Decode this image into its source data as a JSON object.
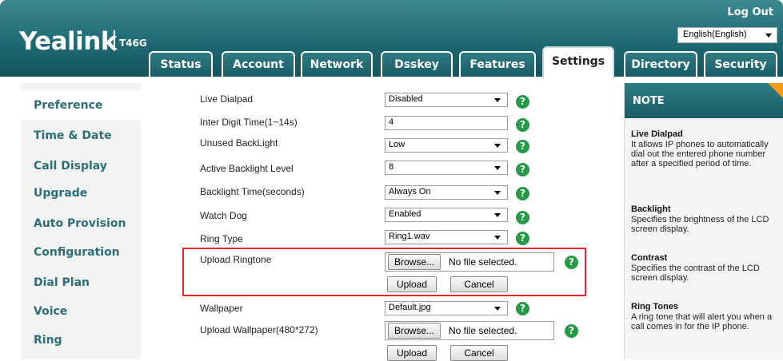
{
  "header": {
    "brand": "Yealink",
    "model": "T46G",
    "logout": "Log Out",
    "language": "English(English)",
    "tabs": [
      "Status",
      "Account",
      "Network",
      "Dsskey",
      "Features",
      "Settings",
      "Directory",
      "Security"
    ],
    "active_tab": "Settings"
  },
  "sidebar": {
    "items": [
      "Preference",
      "Time & Date",
      "Call Display",
      "Upgrade",
      "Auto Provision",
      "Configuration",
      "Dial Plan",
      "Voice",
      "Ring"
    ],
    "active": "Preference"
  },
  "form": {
    "live_dialpad": {
      "label": "Live Dialpad",
      "value": "Disabled"
    },
    "inter_digit": {
      "label": "Inter Digit Time(1~14s)",
      "value": "4"
    },
    "unused_backlight": {
      "label": "Unused BackLight",
      "value": "Low"
    },
    "active_backlight": {
      "label": "Active Backlight Level",
      "value": "8"
    },
    "backlight_time": {
      "label": "Backlight Time(seconds)",
      "value": "Always On"
    },
    "watch_dog": {
      "label": "Watch Dog",
      "value": "Enabled"
    },
    "ring_type": {
      "label": "Ring Type",
      "value": "Ring1.wav"
    },
    "upload_ringtone": {
      "label": "Upload Ringtone",
      "browse": "Browse...",
      "no_file": "No file selected.",
      "upload": "Upload",
      "cancel": "Cancel"
    },
    "wallpaper": {
      "label": "Wallpaper",
      "value": "Default.jpg"
    },
    "upload_wallpaper": {
      "label": "Upload Wallpaper(480*272)",
      "browse": "Browse...",
      "no_file": "No file selected.",
      "upload": "Upload",
      "cancel": "Cancel"
    },
    "help_glyph": "?"
  },
  "note": {
    "title": "NOTE",
    "sections": [
      {
        "heading": "Live Dialpad",
        "text": "It allows IP phones to automatically dial out the entered phone number after a specified period of time."
      },
      {
        "heading": "Backlight",
        "text": "Specifies the brightness of the LCD screen display."
      },
      {
        "heading": "Contrast",
        "text": "Specifies the contrast of the LCD screen display."
      },
      {
        "heading": "Ring Tones",
        "text": "A ring tone that will alert you when a call comes in for the IP phone."
      }
    ]
  },
  "colors": {
    "header": "#1f6a74",
    "nav_text": "#2d6f78",
    "help_icon": "#269a47",
    "highlight": "#e8262a",
    "note_corner": "#f39a1d"
  }
}
